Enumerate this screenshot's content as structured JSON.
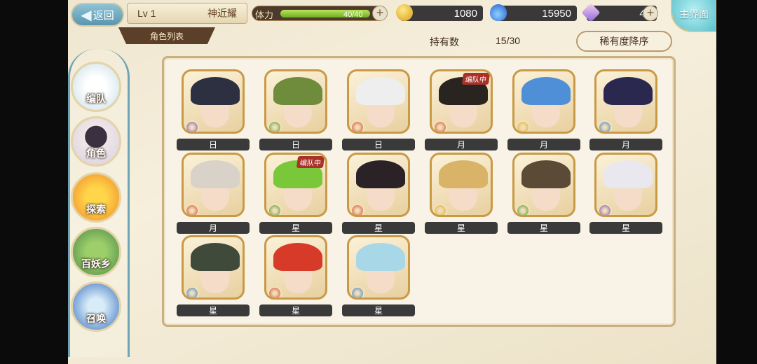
{
  "header": {
    "back_label": "返回",
    "level": "Lv 1",
    "player_name": "神近耀",
    "tab_label": "角色列表",
    "stamina_label": "体力",
    "stamina_value": "40/40",
    "stamina_fraction": 1.0,
    "gold": "1080",
    "soul_fire": "15950",
    "crystal": "40",
    "home_label": "主界面"
  },
  "list_info": {
    "owned_label": "持有数",
    "owned_count": "15/30",
    "sort_label": "稀有度降序"
  },
  "sidebar": {
    "items": [
      {
        "label": "编队"
      },
      {
        "label": "角色"
      },
      {
        "label": "探索"
      },
      {
        "label": "百妖乡"
      },
      {
        "label": "召唤"
      }
    ]
  },
  "squad_badge": "编队中",
  "characters": [
    {
      "name": "日",
      "element": "purple",
      "hair": "#2d3040",
      "in_squad": false
    },
    {
      "name": "日",
      "element": "green",
      "hair": "#6e8c3c",
      "in_squad": false
    },
    {
      "name": "日",
      "element": "red",
      "hair": "#eeeeee",
      "in_squad": false
    },
    {
      "name": "月",
      "element": "red",
      "hair": "#2a2420",
      "in_squad": true
    },
    {
      "name": "月",
      "element": "yellow",
      "hair": "#4f8fd8",
      "in_squad": false
    },
    {
      "name": "月",
      "element": "blue",
      "hair": "#2b2850",
      "in_squad": false
    },
    {
      "name": "月",
      "element": "red",
      "hair": "#d8d2c8",
      "in_squad": false
    },
    {
      "name": "星",
      "element": "green",
      "hair": "#7ac83a",
      "in_squad": true
    },
    {
      "name": "星",
      "element": "red",
      "hair": "#2a2226",
      "in_squad": false
    },
    {
      "name": "星",
      "element": "yellow",
      "hair": "#d9b468",
      "in_squad": false
    },
    {
      "name": "星",
      "element": "green",
      "hair": "#5b4a36",
      "in_squad": false
    },
    {
      "name": "星",
      "element": "purple",
      "hair": "#e8e8ee",
      "in_squad": false
    },
    {
      "name": "星",
      "element": "blue",
      "hair": "#3f4a3a",
      "in_squad": false
    },
    {
      "name": "星",
      "element": "red",
      "hair": "#d83a2a",
      "in_squad": false
    },
    {
      "name": "星",
      "element": "blue",
      "hair": "#a8d8e8",
      "in_squad": false
    }
  ],
  "colors": {
    "purple": "#7b4fb8",
    "green": "#4f9a2c",
    "red": "#d9472b",
    "yellow": "#e3ac22",
    "blue": "#3a7fd0"
  }
}
